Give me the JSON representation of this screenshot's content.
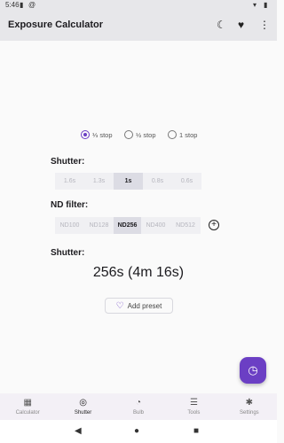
{
  "status_bar": {
    "time": "5:46",
    "icons": [
      "notification-icon",
      "at-icon",
      "wifi-icon",
      "battery-icon"
    ]
  },
  "app_bar": {
    "title": "Exposure Calculator",
    "actions": [
      "moon-icon",
      "heart-icon",
      "more-vertical-icon"
    ]
  },
  "stop_options": [
    {
      "label": "⅓ stop",
      "selected": true
    },
    {
      "label": "½ stop",
      "selected": false
    },
    {
      "label": "1 stop",
      "selected": false
    }
  ],
  "shutter_section": {
    "label": "Shutter:",
    "options": [
      "1.6s",
      "1.3s",
      "1s",
      "0.8s",
      "0.6s"
    ],
    "selected": "1s"
  },
  "nd_section": {
    "label": "ND filter:",
    "options": [
      "ND100",
      "ND128",
      "ND256",
      "ND400",
      "ND512"
    ],
    "selected": "ND256"
  },
  "result_section": {
    "label": "Shutter:",
    "value": "256s (4m 16s)"
  },
  "add_preset": {
    "label": "Add preset"
  },
  "bottom_nav": [
    {
      "label": "Calculator",
      "icon": "calculator-icon",
      "active": false
    },
    {
      "label": "Shutter",
      "icon": "shutter-icon",
      "active": true
    },
    {
      "label": "Bulb",
      "icon": "clock-icon",
      "active": false
    },
    {
      "label": "Tools",
      "icon": "sliders-icon",
      "active": false
    },
    {
      "label": "Settings",
      "icon": "gear-icon",
      "active": false
    }
  ],
  "colors": {
    "accent": "#6b3fc4",
    "app_bar": "#e7e7ea",
    "segment_bg": "#f0f0f3",
    "segment_selected": "#dcdce4"
  }
}
